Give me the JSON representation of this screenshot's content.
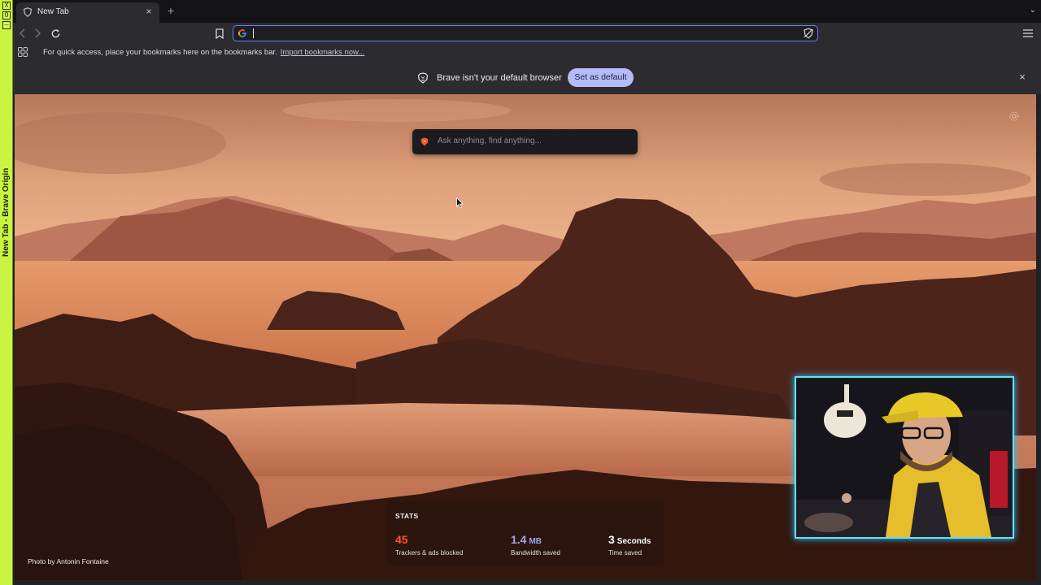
{
  "window": {
    "wm_title": "New Tab - Brave Origin",
    "wm_buttons": [
      "X",
      "O",
      "—"
    ]
  },
  "tab": {
    "title": "New Tab",
    "close_glyph": "×",
    "new_tab_glyph": "+",
    "menu_glyph": "⌄"
  },
  "toolbar": {
    "back_icon": "chevron-left-icon",
    "forward_icon": "chevron-right-icon",
    "reload_icon": "reload-icon",
    "bookmark_icon": "bookmark-icon",
    "menu_icon": "hamburger-icon",
    "address_value": ""
  },
  "bookmarks_bar": {
    "message": "For quick access, place your bookmarks here on the bookmarks bar.",
    "import_link": "Import bookmarks now..."
  },
  "infobar": {
    "message": "Brave isn't your default browser",
    "button": "Set as default",
    "close": "×"
  },
  "ntp": {
    "ask_placeholder": "Ask anything, find anything...",
    "stats": {
      "title": "STATS",
      "trackers": {
        "value": "45",
        "label": "Trackers & ads blocked",
        "color": "#fb542b"
      },
      "bandwidth": {
        "value": "1.4",
        "unit": "MB",
        "label": "Bandwidth saved",
        "color": "#a0a5eb"
      },
      "time": {
        "value": "3",
        "unit": "Seconds",
        "label": "Time saved",
        "color": "#ffffff"
      }
    },
    "photo_credit": "Photo by Antonin Fontaine"
  },
  "colors": {
    "accent": "#6f7bf0",
    "default_button": "#b4bbf8",
    "webcam_border": "#5fe3ff",
    "wm_strip": "#c9f542"
  }
}
